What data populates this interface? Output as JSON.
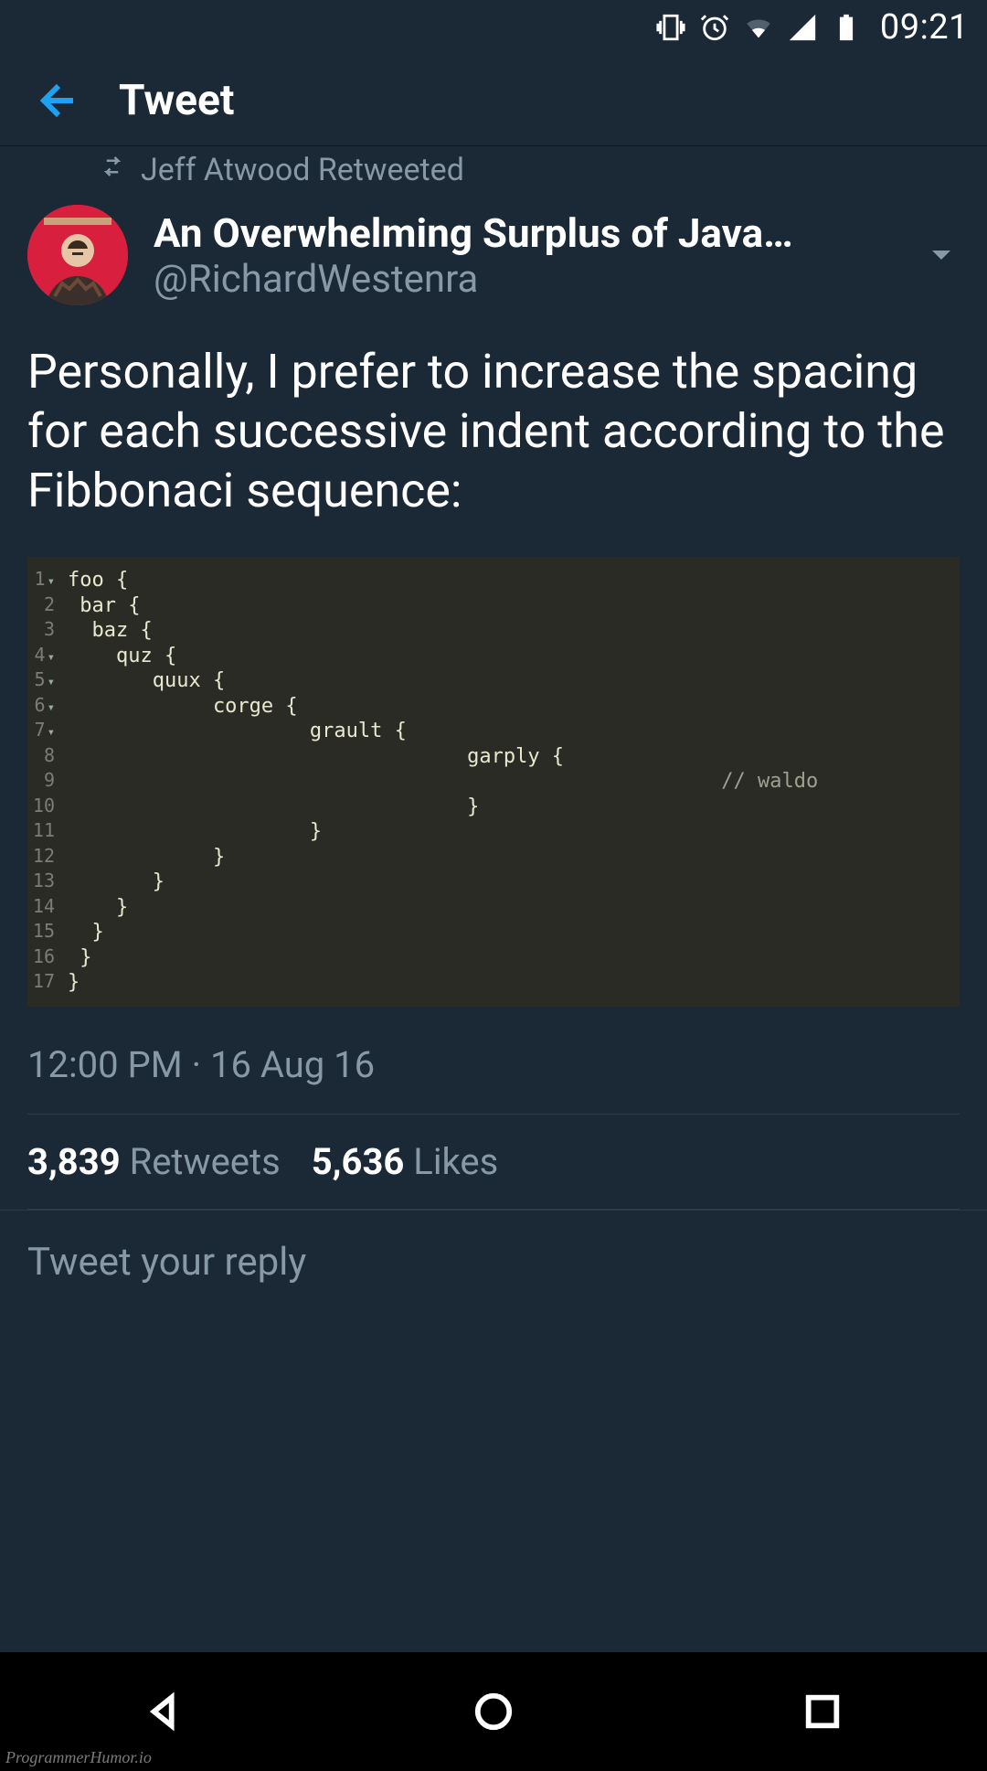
{
  "status": {
    "time": "09:21",
    "icons": [
      "vibrate-icon",
      "alarm-icon",
      "wifi-icon",
      "signal-icon",
      "battery-icon"
    ]
  },
  "appbar": {
    "title": "Tweet"
  },
  "retweet": {
    "label": "Jeff Atwood Retweeted"
  },
  "user": {
    "display_name": "An Overwhelming Surplus of Java…",
    "handle": "@RichardWestenra"
  },
  "tweet": {
    "text": "Personally, I prefer to increase the spacing for each successive indent according to the Fibbonaci sequence:"
  },
  "code": {
    "lines": [
      "foo {",
      " bar {",
      "  baz {",
      "    quz {",
      "       quux {",
      "            corge {",
      "                    grault {",
      "                                 garply {",
      "                                                      // waldo",
      "                                 }",
      "                    }",
      "            }",
      "       }",
      "    }",
      "  }",
      " }",
      "}"
    ],
    "fold_rows": [
      1,
      4,
      5,
      6,
      7
    ]
  },
  "meta": {
    "time": "12:00 PM",
    "sep": " · ",
    "date": "16 Aug 16"
  },
  "stats": {
    "retweets_count": "3,839",
    "retweets_label": " Retweets",
    "likes_count": "5,636",
    "likes_label": " Likes"
  },
  "reply": {
    "placeholder": "Tweet your reply"
  },
  "watermark": "ProgrammerHumor.io"
}
